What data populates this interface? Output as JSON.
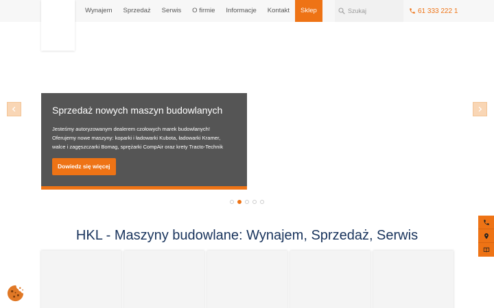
{
  "header": {
    "nav": [
      {
        "label": "Wynajem",
        "name": "nav-item-wynajem",
        "active": false
      },
      {
        "label": "Sprzedaż",
        "name": "nav-item-sprzedaz",
        "active": false
      },
      {
        "label": "Serwis",
        "name": "nav-item-serwis",
        "active": false
      },
      {
        "label": "O firmie",
        "name": "nav-item-o-firmie",
        "active": false
      },
      {
        "label": "Informacje",
        "name": "nav-item-informacje",
        "active": false
      },
      {
        "label": "Kontakt",
        "name": "nav-item-kontakt",
        "active": false
      },
      {
        "label": "Sklep",
        "name": "nav-item-sklep",
        "active": true
      }
    ],
    "search": {
      "placeholder": "Szukaj",
      "value": ""
    },
    "phone": "61 333 222 1"
  },
  "hero": {
    "title": "Sprzedaż nowych maszyn budowlanych",
    "text_lines": [
      "Jesteśmy autoryzowanym dealerem czołowych marek budowlanych!",
      "Oferujemy nowe maszyny: koparki i ładowarki Kubota, ładowarki Kramer,",
      "walce i zagęszczarki Bomag, sprężarki CompAir oraz krety Tracto-Technik"
    ],
    "button_label": "Dowiedz się więcej",
    "slide_count": 5,
    "active_slide": 2
  },
  "main": {
    "heading": "HKL - Maszyny budowlane: Wynajem, Sprzedaż, Serwis",
    "card_count": 5
  },
  "side_contact": [
    "phone-icon",
    "map-pin-icon",
    "book-icon"
  ],
  "colors": {
    "accent": "#ee7315",
    "heading": "#17325b",
    "slide_bg": "#555555"
  }
}
